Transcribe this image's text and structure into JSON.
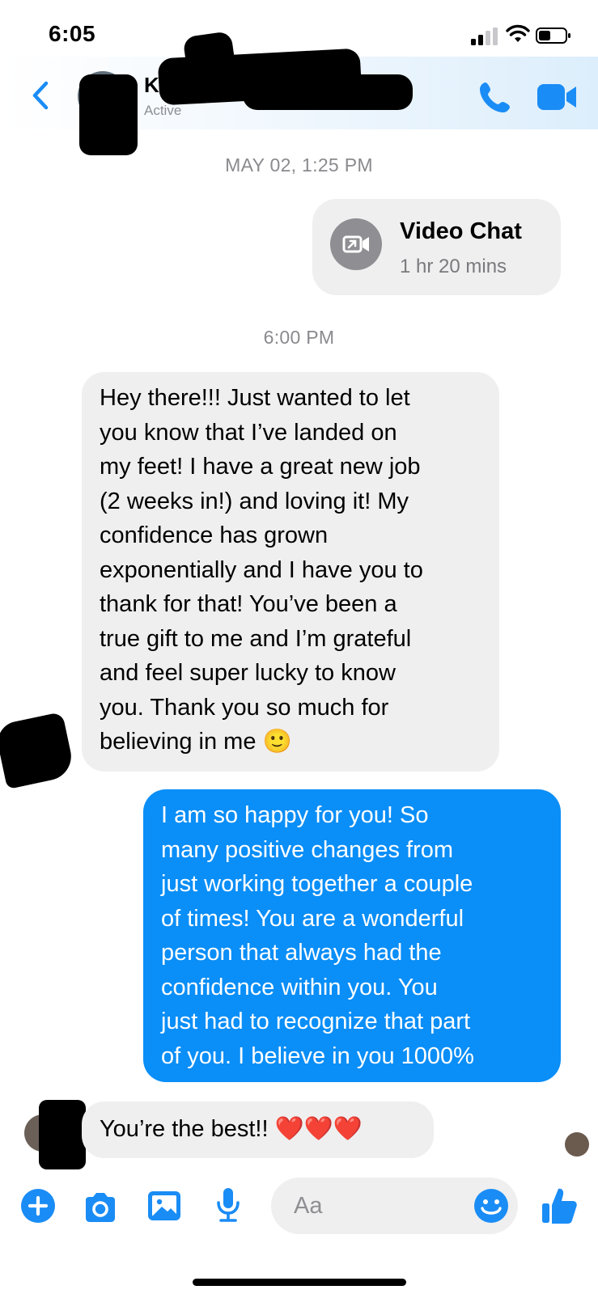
{
  "status_bar": {
    "time": "6:05"
  },
  "header": {
    "contact_name": "K",
    "contact_status": "Active",
    "accent_color": "#1a8cf5"
  },
  "conversation": {
    "timestamp_1": "MAY 02, 1:25 PM",
    "video_chat": {
      "title": "Video Chat",
      "duration": "1 hr 20 mins"
    },
    "timestamp_2": "6:00 PM",
    "messages": [
      {
        "direction": "incoming",
        "text": "Hey there!!! Just wanted to let\nyou know that I’ve landed on\nmy feet! I have a great new job\n(2 weeks in!) and loving it! My\nconfidence has grown\nexponentially and I have you to\nthank for that! You’ve been a\ntrue gift to me and I’m grateful\nand feel super lucky to know\nyou. Thank you so much for\nbelieving in me 🙂"
      },
      {
        "direction": "outgoing",
        "text": "I am so happy for you!  So\nmany positive changes from\njust working together a couple\nof times!   You are a wonderful\nperson that always had the\nconfidence within you.  You\njust had to recognize that part\nof you.  I believe in you 1000%"
      },
      {
        "direction": "incoming",
        "text": "You’re the best!! ❤️❤️❤️"
      }
    ],
    "outgoing_bubble_color": "#0a8ef7",
    "incoming_bubble_color": "#efefef"
  },
  "composer": {
    "placeholder": "Aa",
    "icons": [
      "plus-icon",
      "camera-icon",
      "gallery-icon",
      "microphone-icon",
      "emoji-icon",
      "thumbs-up-icon"
    ]
  }
}
